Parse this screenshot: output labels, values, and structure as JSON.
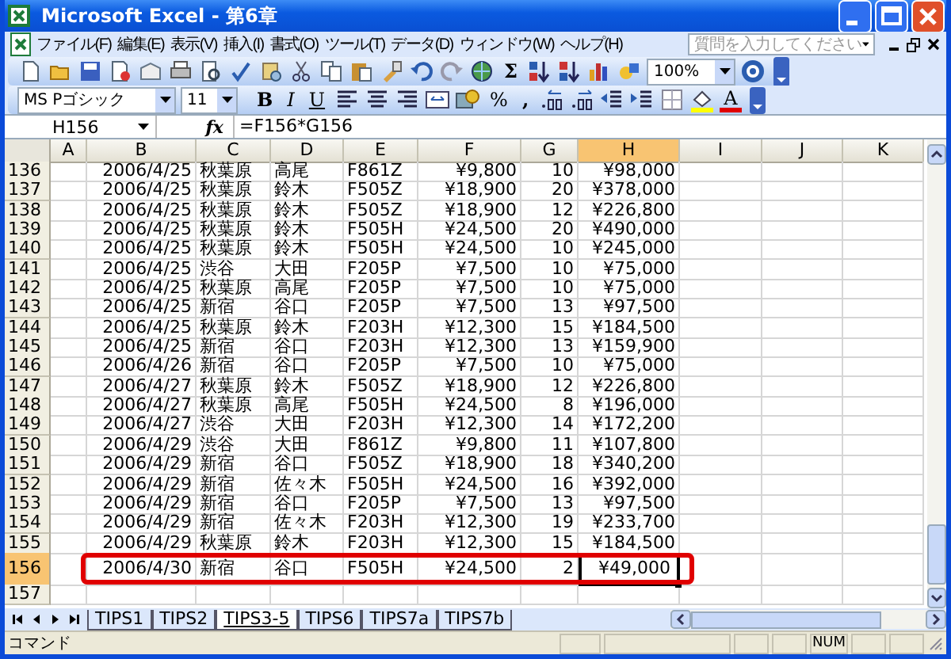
{
  "window": {
    "title": "Microsoft Excel - 第6章"
  },
  "menu": {
    "items": [
      "ファイル(F)",
      "編集(E)",
      "表示(V)",
      "挿入(I)",
      "書式(O)",
      "ツール(T)",
      "データ(D)",
      "ウィンドウ(W)",
      "ヘルプ(H)"
    ],
    "help_box": {
      "placeholder": "質問を入力してください"
    }
  },
  "standard_toolbar": {
    "autosum": "Σ",
    "zoom": "100%"
  },
  "formatting_toolbar": {
    "font": "MS Pゴシック",
    "size": "11",
    "style_buttons": [
      "B",
      "I",
      "U"
    ],
    "percent": "%",
    "comma": ",",
    "font_color": "A"
  },
  "formula_bar": {
    "name_box": "H156",
    "function_label": "fx",
    "formula": "=F156*G156"
  },
  "sheet": {
    "columns": [
      {
        "label": "A",
        "selected": false
      },
      {
        "label": "B",
        "selected": false
      },
      {
        "label": "C",
        "selected": false
      },
      {
        "label": "D",
        "selected": false
      },
      {
        "label": "E",
        "selected": false
      },
      {
        "label": "F",
        "selected": false
      },
      {
        "label": "G",
        "selected": false
      },
      {
        "label": "H",
        "selected": true
      },
      {
        "label": "I",
        "selected": false
      },
      {
        "label": "J",
        "selected": false
      },
      {
        "label": "K",
        "selected": false
      }
    ],
    "rows": [
      {
        "header": "136",
        "selected": false,
        "highlighted": false,
        "cells": [
          "",
          "2006/4/25",
          "秋葉原",
          "高尾",
          "F861Z",
          "¥9,800",
          "10",
          "¥98,000"
        ]
      },
      {
        "header": "137",
        "selected": false,
        "highlighted": false,
        "cells": [
          "",
          "2006/4/25",
          "秋葉原",
          "鈴木",
          "F505Z",
          "¥18,900",
          "20",
          "¥378,000"
        ]
      },
      {
        "header": "138",
        "selected": false,
        "highlighted": false,
        "cells": [
          "",
          "2006/4/25",
          "秋葉原",
          "鈴木",
          "F505Z",
          "¥18,900",
          "12",
          "¥226,800"
        ]
      },
      {
        "header": "139",
        "selected": false,
        "highlighted": false,
        "cells": [
          "",
          "2006/4/25",
          "秋葉原",
          "鈴木",
          "F505H",
          "¥24,500",
          "20",
          "¥490,000"
        ]
      },
      {
        "header": "140",
        "selected": false,
        "highlighted": false,
        "cells": [
          "",
          "2006/4/25",
          "秋葉原",
          "鈴木",
          "F505H",
          "¥24,500",
          "10",
          "¥245,000"
        ]
      },
      {
        "header": "141",
        "selected": false,
        "highlighted": false,
        "cells": [
          "",
          "2006/4/25",
          "渋谷",
          "大田",
          "F205P",
          "¥7,500",
          "10",
          "¥75,000"
        ]
      },
      {
        "header": "142",
        "selected": false,
        "highlighted": false,
        "cells": [
          "",
          "2006/4/25",
          "秋葉原",
          "高尾",
          "F205P",
          "¥7,500",
          "10",
          "¥75,000"
        ]
      },
      {
        "header": "143",
        "selected": false,
        "highlighted": false,
        "cells": [
          "",
          "2006/4/25",
          "新宿",
          "谷口",
          "F205P",
          "¥7,500",
          "13",
          "¥97,500"
        ]
      },
      {
        "header": "144",
        "selected": false,
        "highlighted": false,
        "cells": [
          "",
          "2006/4/25",
          "秋葉原",
          "鈴木",
          "F203H",
          "¥12,300",
          "15",
          "¥184,500"
        ]
      },
      {
        "header": "145",
        "selected": false,
        "highlighted": false,
        "cells": [
          "",
          "2006/4/25",
          "新宿",
          "谷口",
          "F203H",
          "¥12,300",
          "13",
          "¥159,900"
        ]
      },
      {
        "header": "146",
        "selected": false,
        "highlighted": false,
        "cells": [
          "",
          "2006/4/26",
          "新宿",
          "谷口",
          "F205P",
          "¥7,500",
          "10",
          "¥75,000"
        ]
      },
      {
        "header": "147",
        "selected": false,
        "highlighted": false,
        "cells": [
          "",
          "2006/4/27",
          "秋葉原",
          "鈴木",
          "F505Z",
          "¥18,900",
          "12",
          "¥226,800"
        ]
      },
      {
        "header": "148",
        "selected": false,
        "highlighted": false,
        "cells": [
          "",
          "2006/4/27",
          "秋葉原",
          "高尾",
          "F505H",
          "¥24,500",
          "8",
          "¥196,000"
        ]
      },
      {
        "header": "149",
        "selected": false,
        "highlighted": false,
        "cells": [
          "",
          "2006/4/27",
          "渋谷",
          "大田",
          "F203H",
          "¥12,300",
          "14",
          "¥172,200"
        ]
      },
      {
        "header": "150",
        "selected": false,
        "highlighted": false,
        "cells": [
          "",
          "2006/4/29",
          "渋谷",
          "大田",
          "F861Z",
          "¥9,800",
          "11",
          "¥107,800"
        ]
      },
      {
        "header": "151",
        "selected": false,
        "highlighted": false,
        "cells": [
          "",
          "2006/4/29",
          "新宿",
          "谷口",
          "F505Z",
          "¥18,900",
          "18",
          "¥340,200"
        ]
      },
      {
        "header": "152",
        "selected": false,
        "highlighted": false,
        "cells": [
          "",
          "2006/4/29",
          "新宿",
          "佐々木",
          "F505H",
          "¥24,500",
          "16",
          "¥392,000"
        ]
      },
      {
        "header": "153",
        "selected": false,
        "highlighted": false,
        "cells": [
          "",
          "2006/4/29",
          "新宿",
          "谷口",
          "F205P",
          "¥7,500",
          "13",
          "¥97,500"
        ]
      },
      {
        "header": "154",
        "selected": false,
        "highlighted": false,
        "cells": [
          "",
          "2006/4/29",
          "新宿",
          "佐々木",
          "F203H",
          "¥12,300",
          "19",
          "¥233,700"
        ]
      },
      {
        "header": "155",
        "selected": false,
        "highlighted": false,
        "cells": [
          "",
          "2006/4/29",
          "秋葉原",
          "鈴木",
          "F203H",
          "¥12,300",
          "15",
          "¥184,500"
        ]
      },
      {
        "header": "156",
        "selected": true,
        "highlighted": true,
        "cells": [
          "",
          "2006/4/30",
          "新宿",
          "谷口",
          "F505H",
          "¥24,500",
          "2",
          "¥49,000"
        ]
      },
      {
        "header": "157",
        "selected": false,
        "highlighted": false,
        "cells": []
      }
    ]
  },
  "sheet_tabs": [
    {
      "label": "TIPS1",
      "selected": false
    },
    {
      "label": "TIPS2",
      "selected": false
    },
    {
      "label": "TIPS3-5",
      "selected": true
    },
    {
      "label": "TIPS6",
      "selected": false
    },
    {
      "label": "TIPS7a",
      "selected": false
    },
    {
      "label": "TIPS7b",
      "selected": false
    }
  ],
  "status_bar": {
    "mode": "コマンド",
    "indicators": [
      "NUM"
    ]
  }
}
